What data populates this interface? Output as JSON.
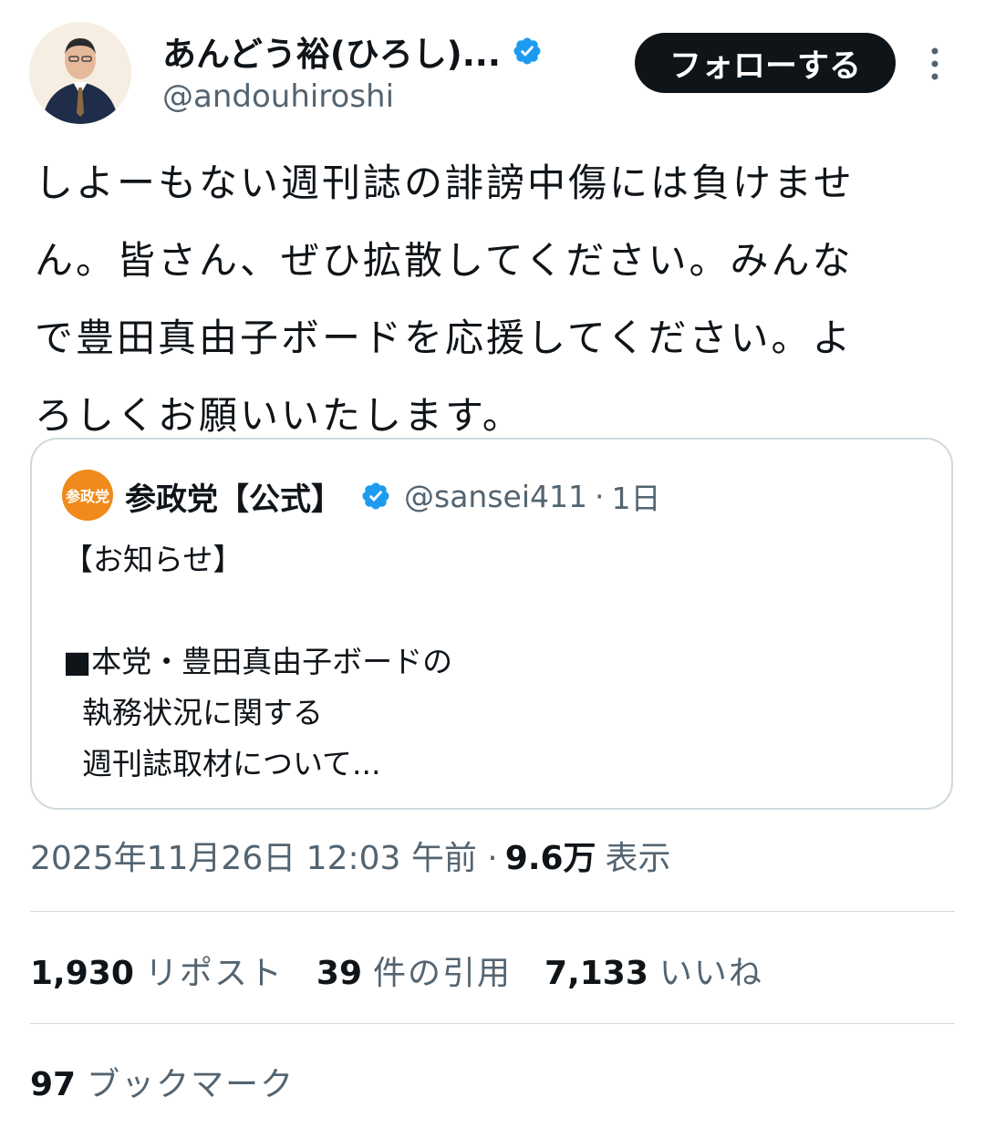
{
  "author": {
    "display_name": "あんどう裕(ひろし)...",
    "handle": "@andouhiroshi"
  },
  "follow_button_label": "フォローする",
  "tweet_text": "しよーもない週刊誌の誹謗中傷には負けませ\nん。皆さん、ぜひ拡散してください。みんな\nで豊田真由子ボードを応援してください。よ\nろしくお願いいたします。",
  "quote": {
    "avatar_text": "参政党",
    "display_name": "参政党【公式】",
    "handle": "@sansei411",
    "separator": "·",
    "time": "1日",
    "text": "【お知らせ】\n\n■本党・豊田真由子ボードの\n  執務状況に関する\n  週刊誌取材について..."
  },
  "meta": {
    "timestamp": "2025年11月26日 12:03 午前 ·",
    "views": "9.6万",
    "views_label": "表示"
  },
  "stats": {
    "reposts_count": "1,930",
    "reposts_label": "リポスト",
    "quotes_count": "39",
    "quotes_label": "件の引用",
    "likes_count": "7,133",
    "likes_label": "いいね"
  },
  "bookmarks": {
    "count": "97",
    "label": "ブックマーク"
  },
  "colors": {
    "text_primary": "#0f1419",
    "text_secondary": "#536471",
    "verified_blue": "#1d9bf0",
    "border": "#cfd9de",
    "party_orange": "#f08a1c"
  }
}
